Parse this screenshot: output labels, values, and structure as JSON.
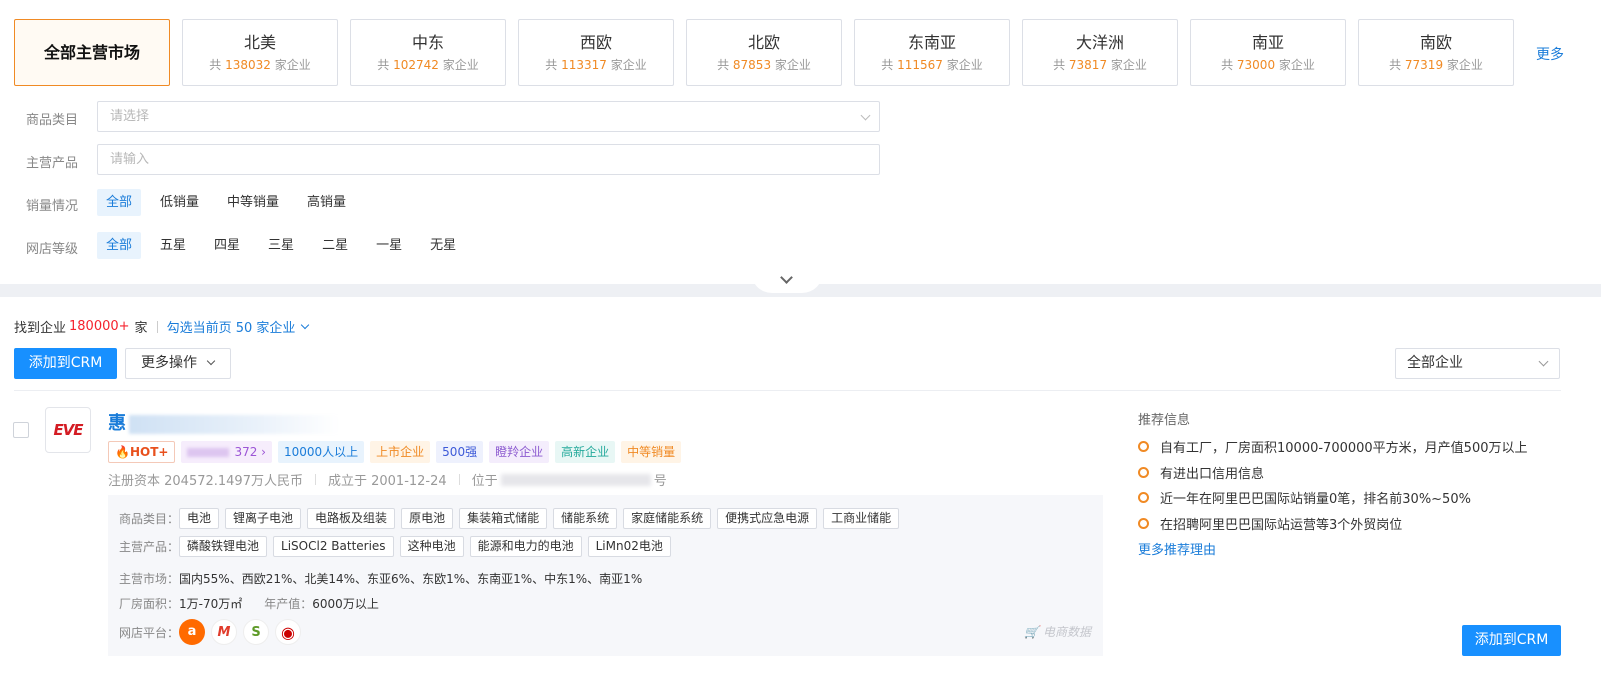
{
  "markets": [
    {
      "name": "全部主营市场",
      "count": "",
      "active": true
    },
    {
      "name": "北美",
      "count": "138032"
    },
    {
      "name": "中东",
      "count": "102742"
    },
    {
      "name": "西欧",
      "count": "113317"
    },
    {
      "name": "北欧",
      "count": "87853"
    },
    {
      "name": "东南亚",
      "count": "111567"
    },
    {
      "name": "大洋洲",
      "count": "73817"
    },
    {
      "name": "南亚",
      "count": "73000"
    },
    {
      "name": "南欧",
      "count": "77319"
    }
  ],
  "count_prefix": "共",
  "count_suffix": "家企业",
  "more_link": "更多",
  "filters": {
    "category_label": "商品类目",
    "category_placeholder": "请选择",
    "product_label": "主营产品",
    "product_placeholder": "请输入",
    "sales_label": "销量情况",
    "sales_options": [
      "全部",
      "低销量",
      "中等销量",
      "高销量"
    ],
    "store_label": "网店等级",
    "store_options": [
      "全部",
      "五星",
      "四星",
      "三星",
      "二星",
      "一星",
      "无星"
    ]
  },
  "results": {
    "found_prefix": "找到企业",
    "found_count": "180000+",
    "found_suffix": "家",
    "select_page": "勾选当前页 50 家企业"
  },
  "toolbar": {
    "add_crm": "添加到CRM",
    "more_ops": "更多操作",
    "all_companies": "全部企业"
  },
  "company": {
    "logo_text": "EVE",
    "name_visible": "惠",
    "hot": "HOT+",
    "blur_tag_num": "372",
    "tags": [
      {
        "text": "10000人以上",
        "style": "t-blue"
      },
      {
        "text": "上市企业",
        "style": "t-orange"
      },
      {
        "text": "500强",
        "style": "t-ind"
      },
      {
        "text": "瞪羚企业",
        "style": "t-purple"
      },
      {
        "text": "高新企业",
        "style": "t-teal"
      },
      {
        "text": "中等销量",
        "style": "t-orange"
      }
    ],
    "capital": "注册资本 204572.1497万人民币",
    "founded": "成立于 2001-12-24",
    "location_prefix": "位于",
    "location_suffix": "号",
    "category_label": "商品类目：",
    "categories": [
      "电池",
      "锂离子电池",
      "电路板及组装",
      "原电池",
      "集装箱式储能",
      "储能系统",
      "家庭储能系统",
      "便携式应急电源",
      "工商业储能"
    ],
    "product_label": "主营产品：",
    "products": [
      "磷酸铁锂电池",
      "LiSOCl2 Batteries",
      "这种电池",
      "能源和电力的电池",
      "LiMn02电池"
    ],
    "market_label": "主营市场：",
    "market_value": "国内55%、西欧21%、北美14%、东亚6%、东欧1%、东南亚1%、中东1%、南亚1%",
    "area_label": "厂房面积：",
    "area_value": "1万-70万㎡",
    "output_label": "年产值：",
    "output_value": "6000万以上",
    "platform_label": "网店平台：",
    "ecom_data": "电商数据"
  },
  "recommend": {
    "title": "推荐信息",
    "items": [
      "自有工厂，厂房面积10000-700000平方米，月产值500万以上",
      "有进出口信用信息",
      "近一年在阿里巴巴国际站销量0笔，排名前30%~50%",
      "在招聘阿里巴巴国际站运营等3个外贸岗位"
    ],
    "more": "更多推荐理由"
  },
  "colors": {
    "accent": "#f08a24",
    "primary": "#1890ff",
    "link": "#1a7cd9"
  }
}
